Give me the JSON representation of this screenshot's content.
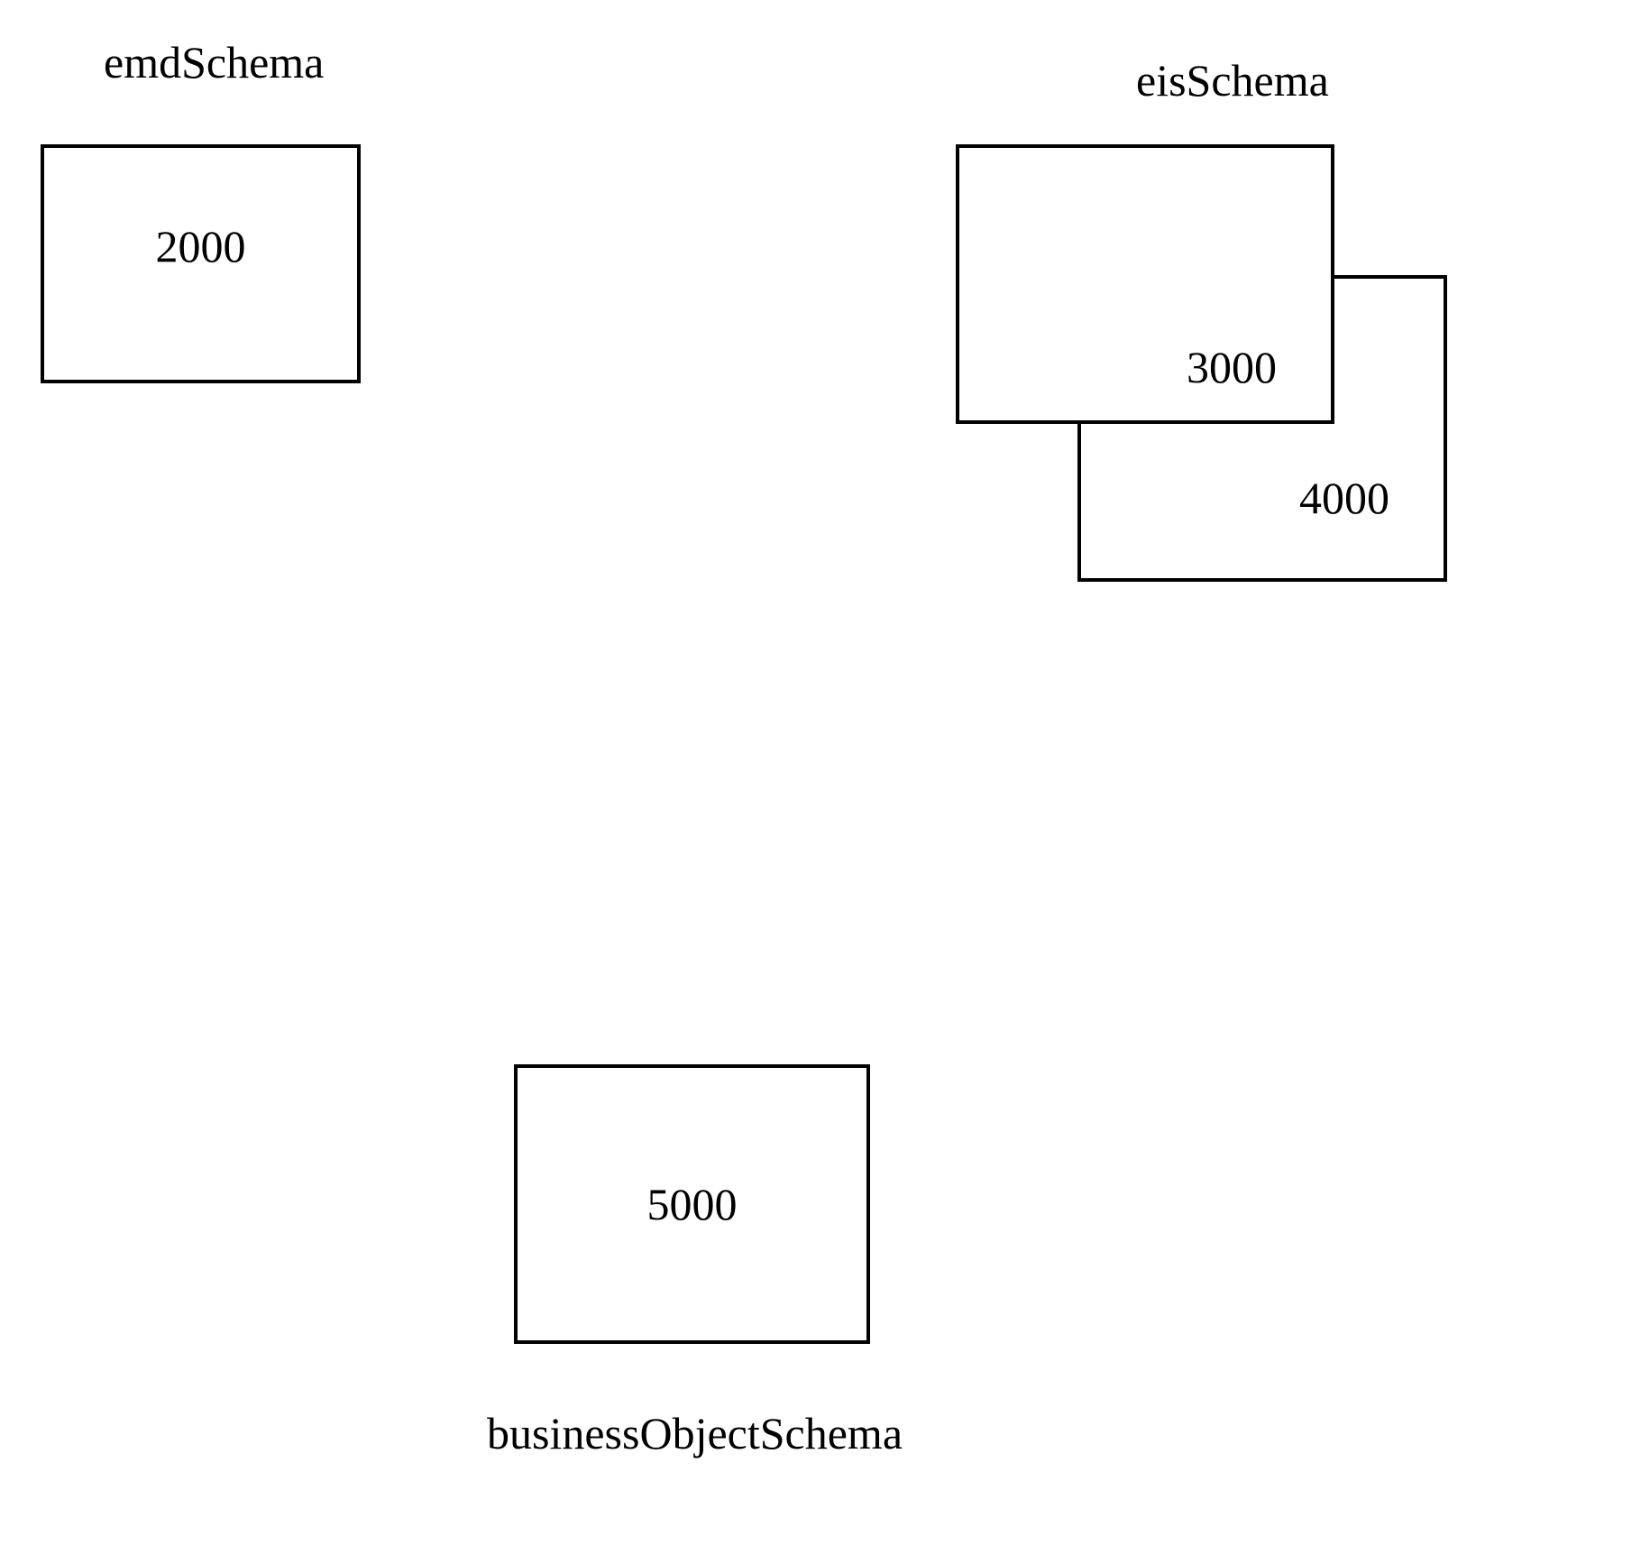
{
  "labels": {
    "emdSchema": "emdSchema",
    "eisSchema": "eisSchema",
    "businessObjectSchema": "businessObjectSchema"
  },
  "boxes": {
    "box2000": "2000",
    "box3000": "3000",
    "box4000": "4000",
    "box5000": "5000"
  }
}
